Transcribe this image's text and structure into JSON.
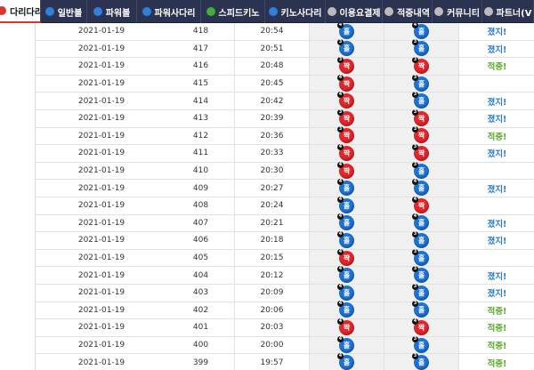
{
  "nav": {
    "tabs": [
      {
        "label": "다리다리",
        "active": true,
        "icon": "red-circle-icon",
        "color": "#e0332b"
      },
      {
        "label": "일반볼",
        "active": false,
        "icon": "blue-circle-icon",
        "color": "#2e7fe0"
      },
      {
        "label": "파워볼",
        "active": false,
        "icon": "blue-circle-icon",
        "color": "#2e7fe0"
      },
      {
        "label": "파워사다리",
        "active": false,
        "icon": "blue-circle-icon",
        "color": "#2e7fe0"
      },
      {
        "label": "스피드키노",
        "active": false,
        "icon": "green-circle-icon",
        "color": "#3fae3a"
      },
      {
        "label": "키노사다리",
        "active": false,
        "icon": "blue-circle-icon",
        "color": "#2e7fe0"
      },
      {
        "label": "이용요결제",
        "active": false,
        "icon": "card-icon",
        "color": "#bbbbbb"
      },
      {
        "label": "적중내역",
        "active": false,
        "icon": "check-icon",
        "color": "#bbbbbb"
      },
      {
        "label": "커뮤니티",
        "active": false,
        "icon": "smile-icon",
        "color": "#bbbbbb"
      },
      {
        "label": "파트너(V",
        "active": false,
        "icon": "person-icon",
        "color": "#bbbbbb"
      }
    ]
  },
  "colors": {
    "odd": "#1c73d6",
    "even": "#e3262b",
    "hit": "#5aab2a",
    "miss": "#2a7bd6"
  },
  "rows": [
    {
      "date": "2021-01-19",
      "no": "418",
      "time": "20:54",
      "r1": "홀",
      "r1n": "4",
      "r2": "홀",
      "r2n": "4",
      "res": "졌지!"
    },
    {
      "date": "2021-01-19",
      "no": "417",
      "time": "20:51",
      "r1": "홀",
      "r1n": "3",
      "r2": "홀",
      "r2n": "3",
      "res": "졌지!"
    },
    {
      "date": "2021-01-19",
      "no": "416",
      "time": "20:48",
      "r1": "짝",
      "r1n": "3",
      "r2": "짝",
      "r2n": "3",
      "res": "적중!"
    },
    {
      "date": "2021-01-19",
      "no": "415",
      "time": "20:45",
      "r1": "짝",
      "r1n": "4",
      "r2": "홀",
      "r2n": "3",
      "res": ""
    },
    {
      "date": "2021-01-19",
      "no": "414",
      "time": "20:42",
      "r1": "짝",
      "r1n": "4",
      "r2": "홀",
      "r2n": "3",
      "res": "졌지!"
    },
    {
      "date": "2021-01-19",
      "no": "413",
      "time": "20:39",
      "r1": "짝",
      "r1n": "3",
      "r2": "짝",
      "r2n": "3",
      "res": "졌지!"
    },
    {
      "date": "2021-01-19",
      "no": "412",
      "time": "20:36",
      "r1": "짝",
      "r1n": "3",
      "r2": "짝",
      "r2n": "3",
      "res": "적중!"
    },
    {
      "date": "2021-01-19",
      "no": "411",
      "time": "20:33",
      "r1": "짝",
      "r1n": "4",
      "r2": "짝",
      "r2n": "3",
      "res": "졌지!"
    },
    {
      "date": "2021-01-19",
      "no": "410",
      "time": "20:30",
      "r1": "짝",
      "r1n": "4",
      "r2": "홀",
      "r2n": "3",
      "res": ""
    },
    {
      "date": "2021-01-19",
      "no": "409",
      "time": "20:27",
      "r1": "홀",
      "r1n": "4",
      "r2": "홀",
      "r2n": "4",
      "res": "졌지!"
    },
    {
      "date": "2021-01-19",
      "no": "408",
      "time": "20:24",
      "r1": "홀",
      "r1n": "4",
      "r2": "짝",
      "r2n": "4",
      "res": ""
    },
    {
      "date": "2021-01-19",
      "no": "407",
      "time": "20:21",
      "r1": "홀",
      "r1n": "4",
      "r2": "홀",
      "r2n": "4",
      "res": "졌지!"
    },
    {
      "date": "2021-01-19",
      "no": "406",
      "time": "20:18",
      "r1": "홀",
      "r1n": "4",
      "r2": "홀",
      "r2n": "3",
      "res": "졌지!"
    },
    {
      "date": "2021-01-19",
      "no": "405",
      "time": "20:15",
      "r1": "짝",
      "r1n": "4",
      "r2": "홀",
      "r2n": "3",
      "res": ""
    },
    {
      "date": "2021-01-19",
      "no": "404",
      "time": "20:12",
      "r1": "홀",
      "r1n": "4",
      "r2": "홀",
      "r2n": "3",
      "res": "졌지!"
    },
    {
      "date": "2021-01-19",
      "no": "403",
      "time": "20:09",
      "r1": "홀",
      "r1n": "4",
      "r2": "홀",
      "r2n": "3",
      "res": "졌지!"
    },
    {
      "date": "2021-01-19",
      "no": "402",
      "time": "20:06",
      "r1": "홀",
      "r1n": "4",
      "r2": "홀",
      "r2n": "3",
      "res": "적중!"
    },
    {
      "date": "2021-01-19",
      "no": "401",
      "time": "20:03",
      "r1": "짝",
      "r1n": "4",
      "r2": "짝",
      "r2n": "4",
      "res": "적중!"
    },
    {
      "date": "2021-01-19",
      "no": "400",
      "time": "20:00",
      "r1": "홀",
      "r1n": "4",
      "r2": "홀",
      "r2n": "3",
      "res": "적중!"
    },
    {
      "date": "2021-01-19",
      "no": "399",
      "time": "19:57",
      "r1": "홀",
      "r1n": "4",
      "r2": "홀",
      "r2n": "3",
      "res": "적중!"
    }
  ]
}
